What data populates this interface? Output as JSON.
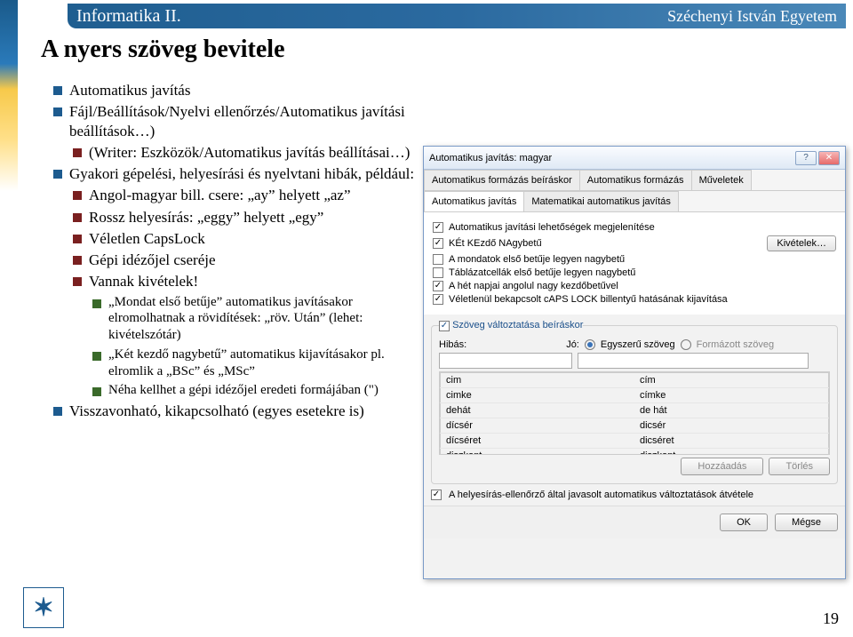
{
  "header": {
    "title": "Informatika II.",
    "uni": "Széchenyi István Egyetem"
  },
  "slide_title": "A nyers szöveg bevitele",
  "page_number": "19",
  "bullets": {
    "b1": "Automatikus javítás",
    "b2": "Fájl/Beállítások/Nyelvi ellenőrzés/Automatikus javítási beállítások…)",
    "b2a": "(Writer: Eszközök/Automatikus javítás beállításai…)",
    "b3": "Gyakori gépelési, helyesírási és nyelvtani hibák, például:",
    "b3a": "Angol-magyar bill. csere: „ay” helyett „az”",
    "b3b": "Rossz helyesírás: „eggy” helyett „egy”",
    "b3c": "Véletlen CapsLock",
    "b3d": "Gépi idézőjel cseréje",
    "b3e": "Vannak kivételek!",
    "b3e1": "„Mondat első betűje” automatikus javításakor elromolhatnak a rövidítések: „röv. Után” (lehet: kivételszótár)",
    "b3e2": "„Két kezdő nagybetű” automatikus kijavításakor pl. elromlik a „BSc” és „MSc”",
    "b3e3": "Néha kellhet a gépi idézőjel eredeti formájában (\")",
    "b4": "Visszavonható, kikapcsolható (egyes esetekre is)"
  },
  "dialog": {
    "title": "Automatikus javítás: magyar",
    "tabs_top": [
      "Automatikus formázás beíráskor",
      "Automatikus formázás",
      "Műveletek"
    ],
    "tabs_bottom": [
      "Automatikus javítás",
      "Matematikai automatikus javítás"
    ],
    "opt1": "Automatikus javítási lehetőségek megjelenítése",
    "opt2": "KÉt KEzdő NAgybetű",
    "opt3": "A mondatok első betűje legyen nagybetű",
    "opt4": "Táblázatcellák első betűje legyen nagybetű",
    "opt5": "A hét napjai angolul nagy kezdőbetűvel",
    "opt6": "Véletlenül bekapcsolt cAPS LOCK billentyű hatásának kijavítása",
    "kivetelek": "Kivételek…",
    "group_title": "Szöveg változtatása beíráskor",
    "hibas_lbl": "Hibás:",
    "jo_lbl": "Jó:",
    "rad1": "Egyszerű szöveg",
    "rad2": "Formázott szöveg",
    "tbl": {
      "rows": [
        [
          "cim",
          "cím"
        ],
        [
          "cimke",
          "címke"
        ],
        [
          "dehát",
          "de hát"
        ],
        [
          "dícsér",
          "dicsér"
        ],
        [
          "dícséret",
          "dicséret"
        ],
        [
          "diszkont",
          "diszkont"
        ]
      ]
    },
    "add_btn": "Hozzáadás",
    "del_btn": "Törlés",
    "chk_bottom": "A helyesírás-ellenőrző által javasolt automatikus változtatások átvétele",
    "ok": "OK",
    "cancel": "Mégse"
  }
}
